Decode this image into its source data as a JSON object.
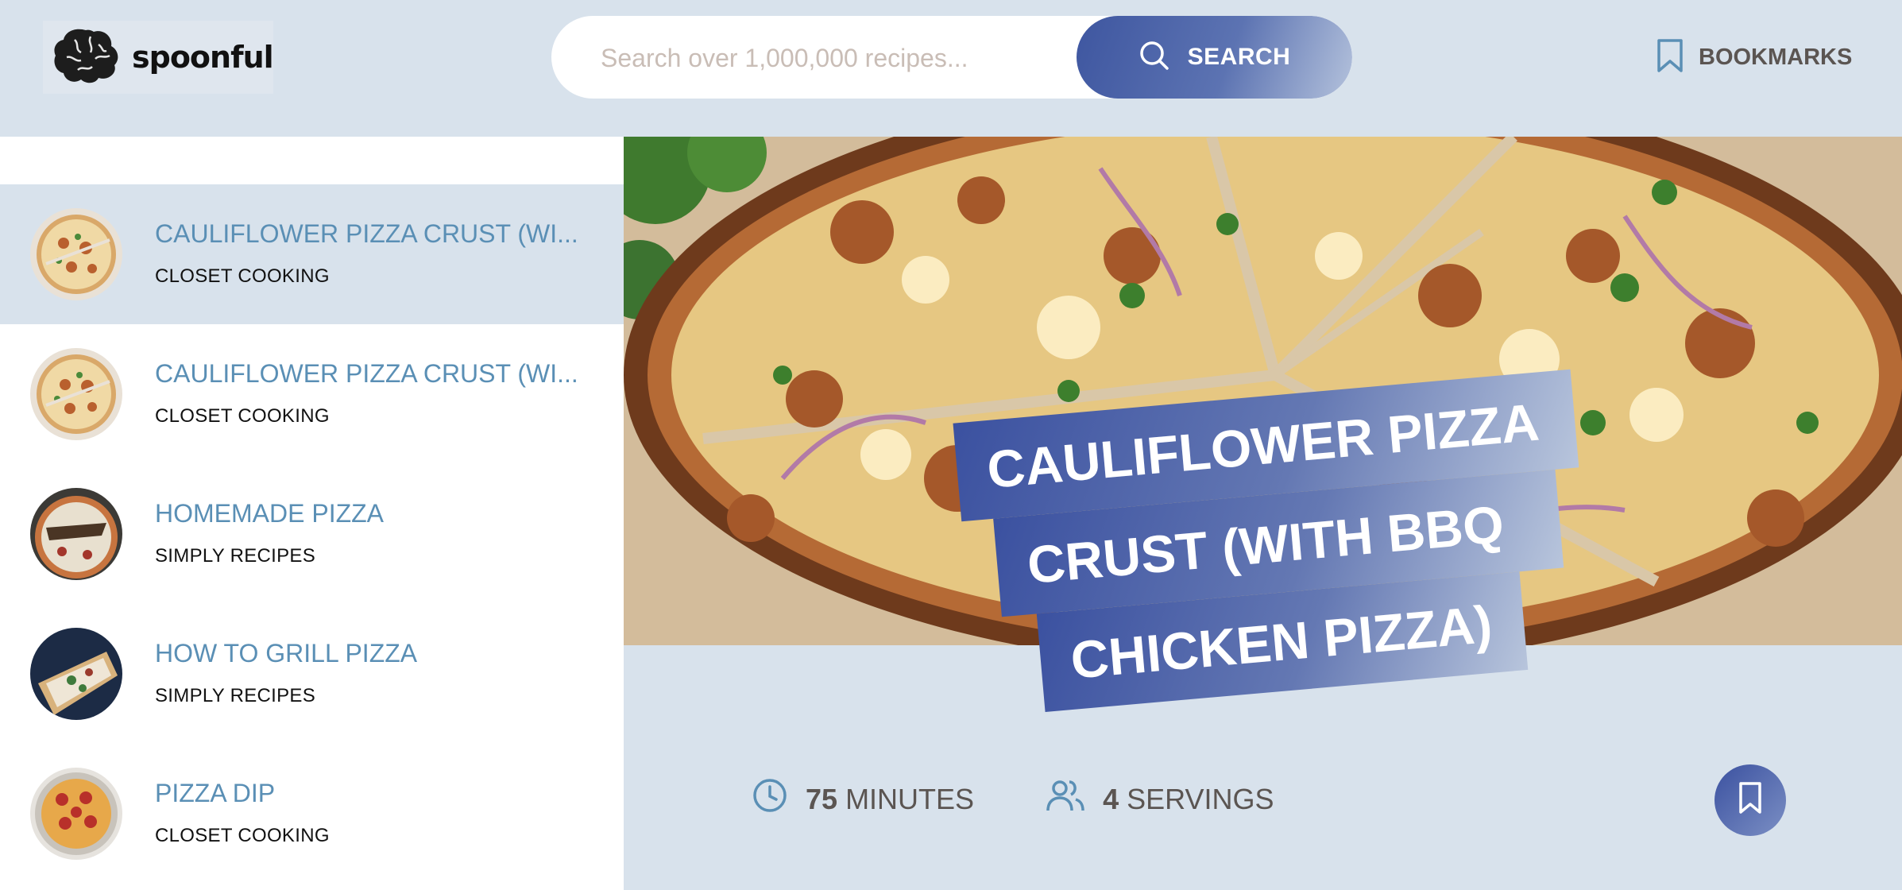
{
  "brand": {
    "name": "spoonful"
  },
  "search": {
    "placeholder": "Search over 1,000,000 recipes...",
    "value": "",
    "button_label": "SEARCH"
  },
  "nav": {
    "bookmarks_label": "BOOKMARKS"
  },
  "results": [
    {
      "title": "CAULIFLOWER PIZZA CRUST (WI...",
      "publisher": "CLOSET COOKING",
      "active": true
    },
    {
      "title": "CAULIFLOWER PIZZA CRUST (WI...",
      "publisher": "CLOSET COOKING",
      "active": false
    },
    {
      "title": "HOMEMADE PIZZA",
      "publisher": "SIMPLY RECIPES",
      "active": false
    },
    {
      "title": "HOW TO GRILL PIZZA",
      "publisher": "SIMPLY RECIPES",
      "active": false
    },
    {
      "title": "PIZZA DIP",
      "publisher": "CLOSET COOKING",
      "active": false
    }
  ],
  "recipe": {
    "title_lines": [
      "CAULIFLOWER PIZZA",
      "CRUST (WITH BBQ",
      "CHICKEN PIZZA)"
    ],
    "cooking_time": "75",
    "cooking_time_unit": "MINUTES",
    "servings": "4",
    "servings_unit": "SERVINGS"
  },
  "colors": {
    "background": "#d8e2ec",
    "accent_start": "#3b51a0",
    "accent_end": "#b8c5dc",
    "title_blue": "#5a8fb5",
    "text_gray": "#5b5552"
  },
  "icons": {
    "logo": "brain-icon",
    "search": "search-icon",
    "bookmark": "bookmark-icon",
    "clock": "clock-icon",
    "servings": "users-icon"
  }
}
